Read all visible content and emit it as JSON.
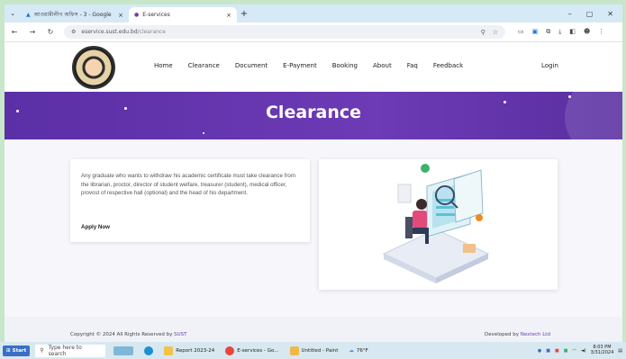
{
  "browser": {
    "tabs": [
      {
        "title": "আওয়ামীলীগ অফিস - 3 - Google",
        "active": false
      },
      {
        "title": "E-services",
        "active": true
      }
    ],
    "url_host": "eservice.sust.edu.bd",
    "url_path": "/clearance"
  },
  "site": {
    "nav": [
      "Home",
      "Clearance",
      "Document",
      "E-Payment",
      "Booking",
      "About",
      "Faq",
      "Feedback"
    ],
    "login": "Login",
    "hero_title": "Clearance",
    "intro": "Any graduate who wants to withdraw his academic certificate must take clearance from the librarian, proctor, director of student welfare, treasurer (student), medical officer, provost of respective hall (optional) and the head of his department.",
    "apply": "Apply Now",
    "footer_copy_prefix": "Copyright © 2024 All Rights Reserved by ",
    "footer_copy_brand": "SUST",
    "footer_dev_prefix": "Developed by ",
    "footer_dev_brand": "Nextech Ltd"
  },
  "taskbar": {
    "start": "Start",
    "search_placeholder": "Type here to search",
    "items": [
      "Report 2023-24",
      "E-services - Go...",
      "Untitled - Paint"
    ],
    "weather": "76°F",
    "time": "8:03 PM",
    "date": "3/31/2024"
  },
  "colors": {
    "hero": "#5b2fa6",
    "accent": "#6a3fb0"
  }
}
